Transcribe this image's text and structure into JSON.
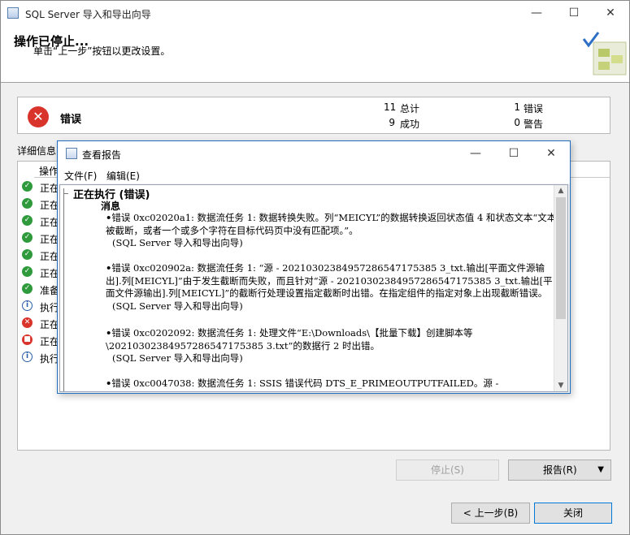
{
  "window": {
    "title": "SQL Server 导入和导出向导"
  },
  "header": {
    "title": "操作已停止...",
    "subtitle": "单击“上一步”按钮以更改设置。"
  },
  "summary": {
    "status_label": "错误",
    "total_count": "11",
    "total_label": "总计",
    "success_count": "9",
    "success_label": "成功",
    "error_count": "1",
    "error_label": "错误",
    "warning_count": "0",
    "warning_label": "警告"
  },
  "details": {
    "label": "详细信息",
    "column_header": "操作",
    "rows": [
      {
        "text": "正在",
        "status": "ok"
      },
      {
        "text": "正在",
        "status": "ok"
      },
      {
        "text": "正在",
        "status": "ok"
      },
      {
        "text": "正在",
        "status": "ok"
      },
      {
        "text": "正在",
        "status": "ok"
      },
      {
        "text": "正在",
        "status": "ok"
      },
      {
        "text": "准备",
        "status": "ok"
      },
      {
        "text": "执行",
        "status": "info"
      },
      {
        "text": "正在",
        "status": "err"
      },
      {
        "text": "正在",
        "status": "stop"
      },
      {
        "text": "执行",
        "status": "info"
      }
    ]
  },
  "buttons": {
    "stop": "停止(S)",
    "report": "报告(R)",
    "back": "< 上一步(B)",
    "close": "关闭"
  },
  "dialog": {
    "title": "查看报告",
    "menu_file": "文件(F)",
    "menu_edit": "编辑(E)",
    "section_title": "正在执行 (错误)",
    "messages_title": "消息",
    "messages": [
      {
        "text": "错误 0xc02020a1: 数据流任务 1: 数据转换失败。列“MEICYL”的数据转换返回状态值 4 和状态文本“文本被截断，或者一个或多个字符在目标代码页中没有匹配项。”。",
        "source": "(SQL Server 导入和导出向导)"
      },
      {
        "text": "错误 0xc020902a: 数据流任务 1: “源 - 20210302384957286547175385 3_txt.输出[平面文件源输出].列[MEICYL]”由于发生截断而失败，而且针对“源 - 20210302384957286547175385 3_txt.输出[平面文件源输出].列[MEICYL]”的截断行处理设置指定截断时出错。在指定组件的指定对象上出现截断错误。",
        "source": "(SQL Server 导入和导出向导)"
      },
      {
        "text": "错误 0xc0202092: 数据流任务 1: 处理文件“E:\\Downloads\\【批量下载】创建脚本等\\20210302384957286547175385 3.txt”的数据行 2 时出错。",
        "source": "(SQL Server 导入和导出向导)"
      },
      {
        "text": "错误 0xc0047038: 数据流任务 1: SSIS 错误代码 DTS_E_PRIMEOUTPUTFAILED。源 -",
        "source": ""
      }
    ]
  }
}
